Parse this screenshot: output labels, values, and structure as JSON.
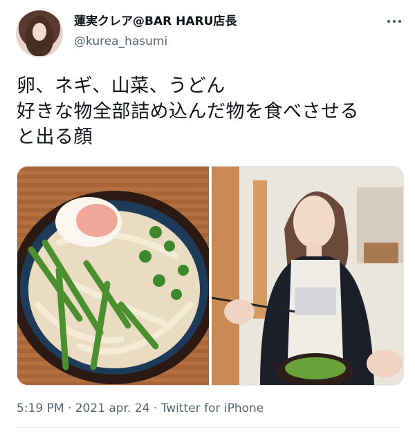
{
  "author": {
    "display_name": "蓮実クレア@BAR HARU店長",
    "handle": "@kurea_hasumi",
    "avatar": "avatar-photo"
  },
  "tweet": {
    "lines": [
      "卵、ネギ、山菜、うどん",
      "好きな物全部詰め込んだ物を食べさせる",
      "と出る顔"
    ]
  },
  "media": [
    {
      "description": "udon-bowl-photo"
    },
    {
      "description": "woman-eating-udon-photo"
    }
  ],
  "footer": {
    "time": "5:19 PM",
    "separator": "·",
    "date": "2021 apr. 24",
    "source": "Twitter for iPhone"
  },
  "icons": {
    "more": "more-horizontal-icon"
  },
  "colors": {
    "text": "#0f1419",
    "secondary": "#536471"
  }
}
